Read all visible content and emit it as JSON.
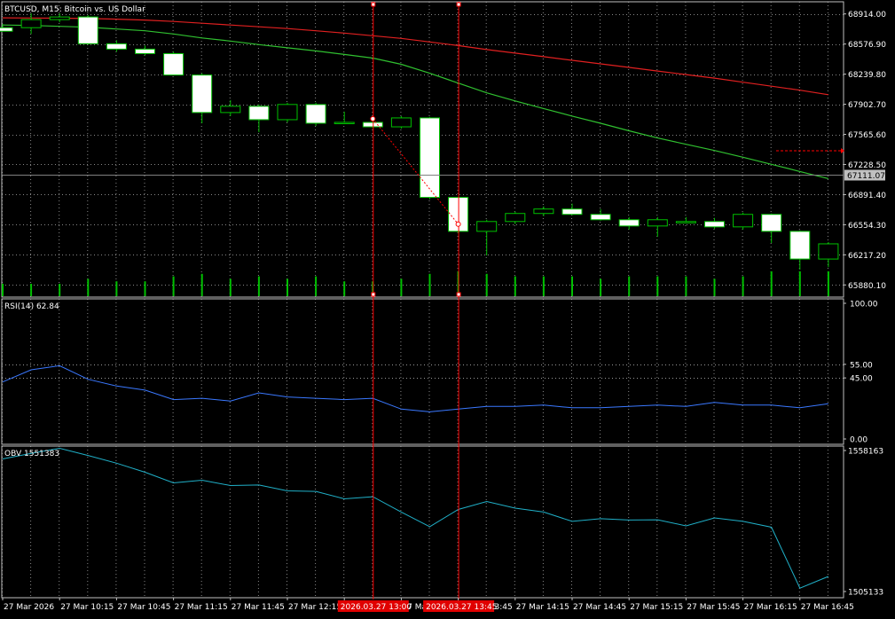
{
  "window_title": "BTCUSD, M15: Bitcoin vs. US Dollar",
  "colors": {
    "background": "#000000",
    "grid": "#c0c0c0",
    "panel_border": "#c0c0c0",
    "text": "#ffffff",
    "candle_bull_fill": "#000000",
    "candle_bear_fill": "#ffffff",
    "candle_outline": "#00c000",
    "volume": "#00c000",
    "ma_slow": "#e02020",
    "ma_fast": "#30c030",
    "rsi_line": "#3a78ff",
    "obv_line": "#20b0c8",
    "cursor_line": "#ff0000",
    "price_line": "#808080",
    "price_badge_bg": "#c0c0c0"
  },
  "x_axis_labels": [
    "27 Mar 2026",
    "27 Mar 10:15",
    "27 Mar 10:45",
    "27 Mar 11:15",
    "27 Mar 11:45",
    "27 Mar 12:15",
    "27 Mar 12:45",
    "27 Mar 13:15",
    "27 Mar 13:45",
    "27 Mar 14:15",
    "27 Mar 14:45",
    "27 Mar 15:15",
    "27 Mar 15:45",
    "27 Mar 16:15",
    "27 Mar 16:45"
  ],
  "cursor_labels": [
    "2026.03.27 13:00",
    "2026.03.27 13:45"
  ],
  "price_badge": "67111.07",
  "chart_data": [
    {
      "type": "candlestick",
      "title": "BTCUSD, M15: Bitcoin vs. US Dollar",
      "ylim": [
        65744.0,
        69050.0
      ],
      "y_ticks": [
        "68914.00",
        "68576.90",
        "68239.80",
        "67902.70",
        "67565.60",
        "67228.50",
        "66891.40",
        "66554.30",
        "66217.20",
        "65880.10"
      ],
      "current_price": 67111.07,
      "candles": [
        {
          "o": 68760,
          "h": 68800,
          "l": 68720,
          "c": 68720
        },
        {
          "o": 68760,
          "h": 68920,
          "l": 68690,
          "c": 68850
        },
        {
          "o": 68850,
          "h": 68920,
          "l": 68820,
          "c": 68880
        },
        {
          "o": 68880,
          "h": 68900,
          "l": 68570,
          "c": 68580
        },
        {
          "o": 68580,
          "h": 68620,
          "l": 68490,
          "c": 68520
        },
        {
          "o": 68520,
          "h": 68560,
          "l": 68450,
          "c": 68470
        },
        {
          "o": 68470,
          "h": 68490,
          "l": 68230,
          "c": 68230
        },
        {
          "o": 68230,
          "h": 68250,
          "l": 67690,
          "c": 67810
        },
        {
          "o": 67810,
          "h": 67950,
          "l": 67770,
          "c": 67880
        },
        {
          "o": 67880,
          "h": 67900,
          "l": 67590,
          "c": 67730
        },
        {
          "o": 67730,
          "h": 67920,
          "l": 67700,
          "c": 67900
        },
        {
          "o": 67900,
          "h": 67920,
          "l": 67660,
          "c": 67690
        },
        {
          "o": 67690,
          "h": 67820,
          "l": 67680,
          "c": 67700
        },
        {
          "o": 67700,
          "h": 67720,
          "l": 67640,
          "c": 67650
        },
        {
          "o": 67650,
          "h": 67770,
          "l": 67630,
          "c": 67750
        },
        {
          "o": 67750,
          "h": 67760,
          "l": 66840,
          "c": 66860
        },
        {
          "o": 66860,
          "h": 66860,
          "l": 66460,
          "c": 66480
        },
        {
          "o": 66480,
          "h": 66610,
          "l": 66210,
          "c": 66590
        },
        {
          "o": 66590,
          "h": 66700,
          "l": 66560,
          "c": 66680
        },
        {
          "o": 66680,
          "h": 66760,
          "l": 66650,
          "c": 66730
        },
        {
          "o": 66730,
          "h": 66790,
          "l": 66660,
          "c": 66670
        },
        {
          "o": 66670,
          "h": 66730,
          "l": 66600,
          "c": 66610
        },
        {
          "o": 66610,
          "h": 66640,
          "l": 66500,
          "c": 66540
        },
        {
          "o": 66540,
          "h": 66640,
          "l": 66420,
          "c": 66610
        },
        {
          "o": 66590,
          "h": 66640,
          "l": 66570,
          "c": 66590
        },
        {
          "o": 66590,
          "h": 66630,
          "l": 66510,
          "c": 66530
        },
        {
          "o": 66530,
          "h": 66690,
          "l": 66500,
          "c": 66670
        },
        {
          "o": 66670,
          "h": 66680,
          "l": 66350,
          "c": 66480
        },
        {
          "o": 66480,
          "h": 66490,
          "l": 66050,
          "c": 66170
        },
        {
          "o": 66170,
          "h": 66360,
          "l": 66080,
          "c": 66340
        }
      ],
      "volumes": [
        0.5,
        0.5,
        0.5,
        0.7,
        0.6,
        0.6,
        0.8,
        0.9,
        0.7,
        0.8,
        0.7,
        0.8,
        0.6,
        0.6,
        0.7,
        0.9,
        1.0,
        0.9,
        0.8,
        0.8,
        0.8,
        0.7,
        0.8,
        0.8,
        0.8,
        0.7,
        0.8,
        1.0,
        1.0,
        1.0
      ],
      "series": [
        {
          "values": [
            68870,
            68868,
            68866,
            68862,
            68855,
            68845,
            68830,
            68810,
            68790,
            68770,
            68750,
            68725,
            68700,
            68670,
            68640,
            68600,
            68560,
            68515,
            68475,
            68435,
            68395,
            68355,
            68315,
            68275,
            68235,
            68195,
            68150,
            68105,
            68060,
            68010
          ]
        },
        {
          "values": [
            68790,
            68785,
            68775,
            68765,
            68745,
            68725,
            68690,
            68645,
            68610,
            68570,
            68535,
            68500,
            68460,
            68420,
            68350,
            68250,
            68140,
            68030,
            67940,
            67855,
            67770,
            67690,
            67605,
            67525,
            67455,
            67385,
            67310,
            67230,
            67150,
            67070
          ]
        }
      ],
      "vertical_markers": [
        13,
        16
      ],
      "drawn_trendline": [
        {
          "candle": 13,
          "price": 67740
        },
        {
          "candle": 16,
          "price": 66560
        }
      ]
    },
    {
      "type": "line",
      "title": "RSI(14) 62.84",
      "ylim": [
        0,
        100
      ],
      "y_ticks": [
        "100.00",
        "55.00",
        "45.00",
        "0.00"
      ],
      "reference_levels": [
        55,
        45
      ],
      "values": [
        42,
        51,
        54,
        44,
        39,
        36,
        29,
        30,
        28,
        34,
        31,
        30,
        29,
        30,
        22,
        20,
        22,
        24,
        24,
        25,
        23,
        23,
        24,
        25,
        24,
        27,
        25,
        25,
        23,
        26
      ]
    },
    {
      "type": "line",
      "title": "OBV 1551383",
      "ylim": [
        1505133,
        1558163
      ],
      "y_ticks": [
        "1558163",
        "1505133"
      ],
      "values": [
        1555000,
        1557100,
        1559000,
        1556300,
        1553400,
        1550000,
        1546000,
        1547000,
        1545000,
        1545200,
        1543000,
        1542800,
        1540000,
        1540800,
        1535000,
        1529500,
        1536000,
        1539000,
        1536500,
        1535000,
        1531500,
        1532500,
        1532000,
        1532100,
        1529800,
        1532800,
        1531500,
        1529300,
        1506400,
        1510800
      ]
    }
  ]
}
